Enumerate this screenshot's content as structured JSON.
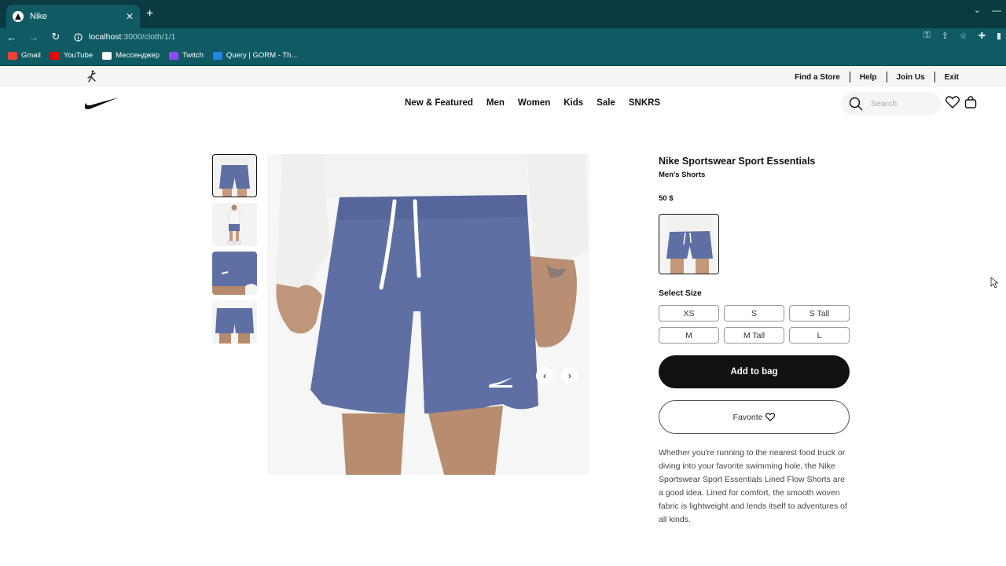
{
  "browser": {
    "tab_title": "Nike",
    "tab_close": "✕",
    "new_tab": "+",
    "url_host": "localhost",
    "url_path": ":3000/cloth/1/1",
    "bookmarks": [
      {
        "label": "Gmail",
        "color": "#ea4335"
      },
      {
        "label": "YouTube",
        "color": "#ff0000"
      },
      {
        "label": "Мессенджер",
        "color": "#ffffff"
      },
      {
        "label": "Twitch",
        "color": "#9146ff"
      },
      {
        "label": "Query | GORM - Th...",
        "color": "#1e88e5"
      }
    ]
  },
  "utility_nav": {
    "links": [
      "Find a Store",
      "Help",
      "Join Us",
      "Exit"
    ]
  },
  "main_nav": {
    "links": [
      "New & Featured",
      "Men",
      "Women",
      "Kids",
      "Sale",
      "SNKRS"
    ],
    "search_placeholder": "Search"
  },
  "product": {
    "title": "Nike Sportswear Sport Essentials",
    "subtitle": "Men's Shorts",
    "price": "50 $",
    "select_size_label": "Select Size",
    "sizes": [
      "XS",
      "S",
      "S Tall",
      "M",
      "M Tall",
      "L"
    ],
    "add_to_bag": "Add to bag",
    "favorite": "Favorite",
    "description": "Whether you're running to the nearest food truck or diving into your favorite swimming hole, the Nike Sportswear Sport Essentials Lined Flow Shorts are a good idea. Lined for comfort, the smooth woven fabric is lightweight and lends itself to adventures of all kinds."
  },
  "colors": {
    "chrome_dark": "#0b3a40",
    "chrome": "#0f5a63",
    "shorts": "#5e6fa3",
    "button_black": "#111111"
  }
}
